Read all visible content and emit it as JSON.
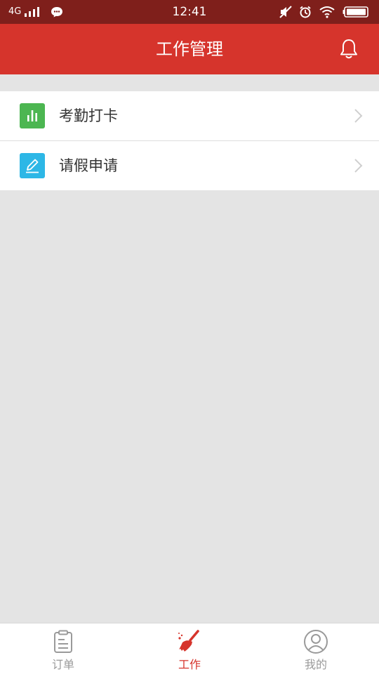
{
  "status_bar": {
    "network": "4G",
    "time": "12:41"
  },
  "header": {
    "title": "工作管理"
  },
  "menu": {
    "items": [
      {
        "label": "考勤打卡",
        "icon": "bar-chart-icon",
        "icon_bg": "#4cb651"
      },
      {
        "label": "请假申请",
        "icon": "edit-icon",
        "icon_bg": "#2db7e6"
      }
    ]
  },
  "tab_bar": {
    "tabs": [
      {
        "label": "订单",
        "icon": "clipboard-icon",
        "active": false
      },
      {
        "label": "工作",
        "icon": "broom-icon",
        "active": true
      },
      {
        "label": "我的",
        "icon": "user-icon",
        "active": false
      }
    ]
  },
  "colors": {
    "status_bar_bg": "#7f1f1b",
    "header_bg": "#d6342c",
    "accent": "#d6342c",
    "page_bg": "#e4e4e4",
    "inactive_tab": "#9a9a9a"
  }
}
